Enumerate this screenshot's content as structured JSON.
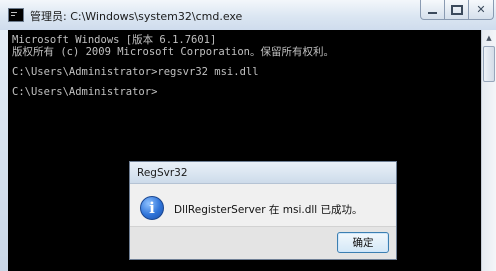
{
  "window": {
    "title": "管理员: C:\\Windows\\system32\\cmd.exe",
    "icon": "cmd-icon",
    "controls": {
      "minimize_icon": "minimize-icon",
      "maximize_icon": "maximize-icon",
      "close_icon": "close-icon",
      "close_glyph": "✕"
    }
  },
  "console": {
    "lines": [
      "Microsoft Windows [版本 6.1.7601]",
      "版权所有 (c) 2009 Microsoft Corporation。保留所有权利。",
      "C:\\Users\\Administrator>regsvr32 msi.dll",
      "C:\\Users\\Administrator>"
    ],
    "text_color": "#c0c0c0",
    "background": "#000000"
  },
  "scrollbar": {
    "up_glyph": "▲"
  },
  "dialog": {
    "title": "RegSvr32",
    "icon": "info-icon",
    "icon_glyph": "i",
    "message": "DllRegisterServer 在 msi.dll 已成功。",
    "ok_label": "确定"
  }
}
